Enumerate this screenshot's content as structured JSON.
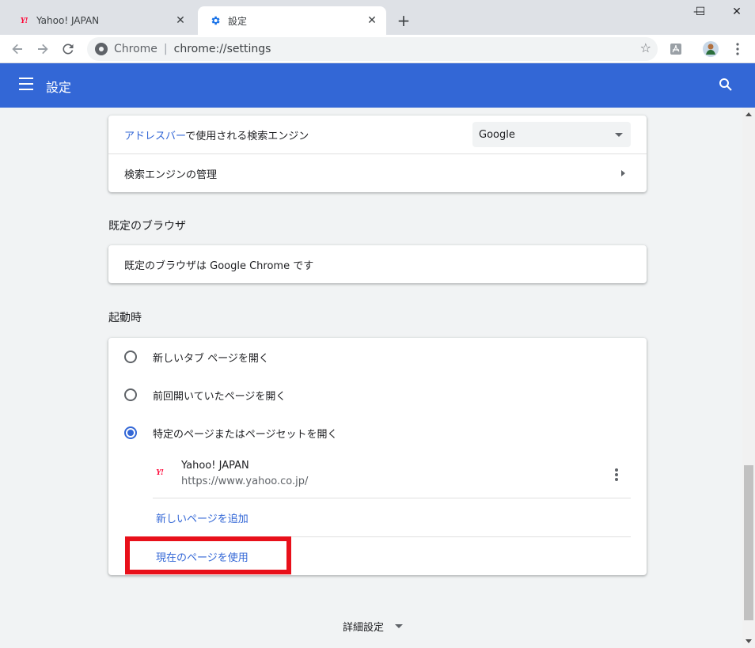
{
  "browser": {
    "tabs": [
      {
        "title": "Yahoo! JAPAN",
        "icon": "yahoo-favicon",
        "favicon_text": "Y!"
      },
      {
        "title": "設定",
        "icon": "gear-icon",
        "active": true
      }
    ],
    "new_tab_label": "+",
    "window_controls": {
      "minimize": "—",
      "maximize": "☐",
      "close": "✕"
    },
    "omnibox": {
      "origin": "Chrome",
      "separator": "|",
      "url": "chrome://settings"
    }
  },
  "settings_header": {
    "title": "設定"
  },
  "search_engine_card": {
    "address_bar_row": {
      "link_text": "アドレスバー",
      "rest_text": "で使用される検索エンジン",
      "selected": "Google"
    },
    "manage_row": {
      "label": "検索エンジンの管理"
    }
  },
  "default_browser_section": {
    "title": "既定のブラウザ",
    "message": "既定のブラウザは Google Chrome です"
  },
  "startup_section": {
    "title": "起動時",
    "options": [
      {
        "label": "新しいタブ ページを開く",
        "checked": false
      },
      {
        "label": "前回開いていたページを開く",
        "checked": false
      },
      {
        "label": "特定のページまたはページセットを開く",
        "checked": true
      }
    ],
    "pages": [
      {
        "name": "Yahoo! JAPAN",
        "url": "https://www.yahoo.co.jp/",
        "favicon_text": "Y!"
      }
    ],
    "add_page_label": "新しいページを追加",
    "use_current_label": "現在のページを使用"
  },
  "advanced": {
    "label": "詳細設定"
  },
  "colors": {
    "header_blue": "#3367d6",
    "highlight_red": "#e8101a",
    "yahoo_red": "#ff0033"
  }
}
